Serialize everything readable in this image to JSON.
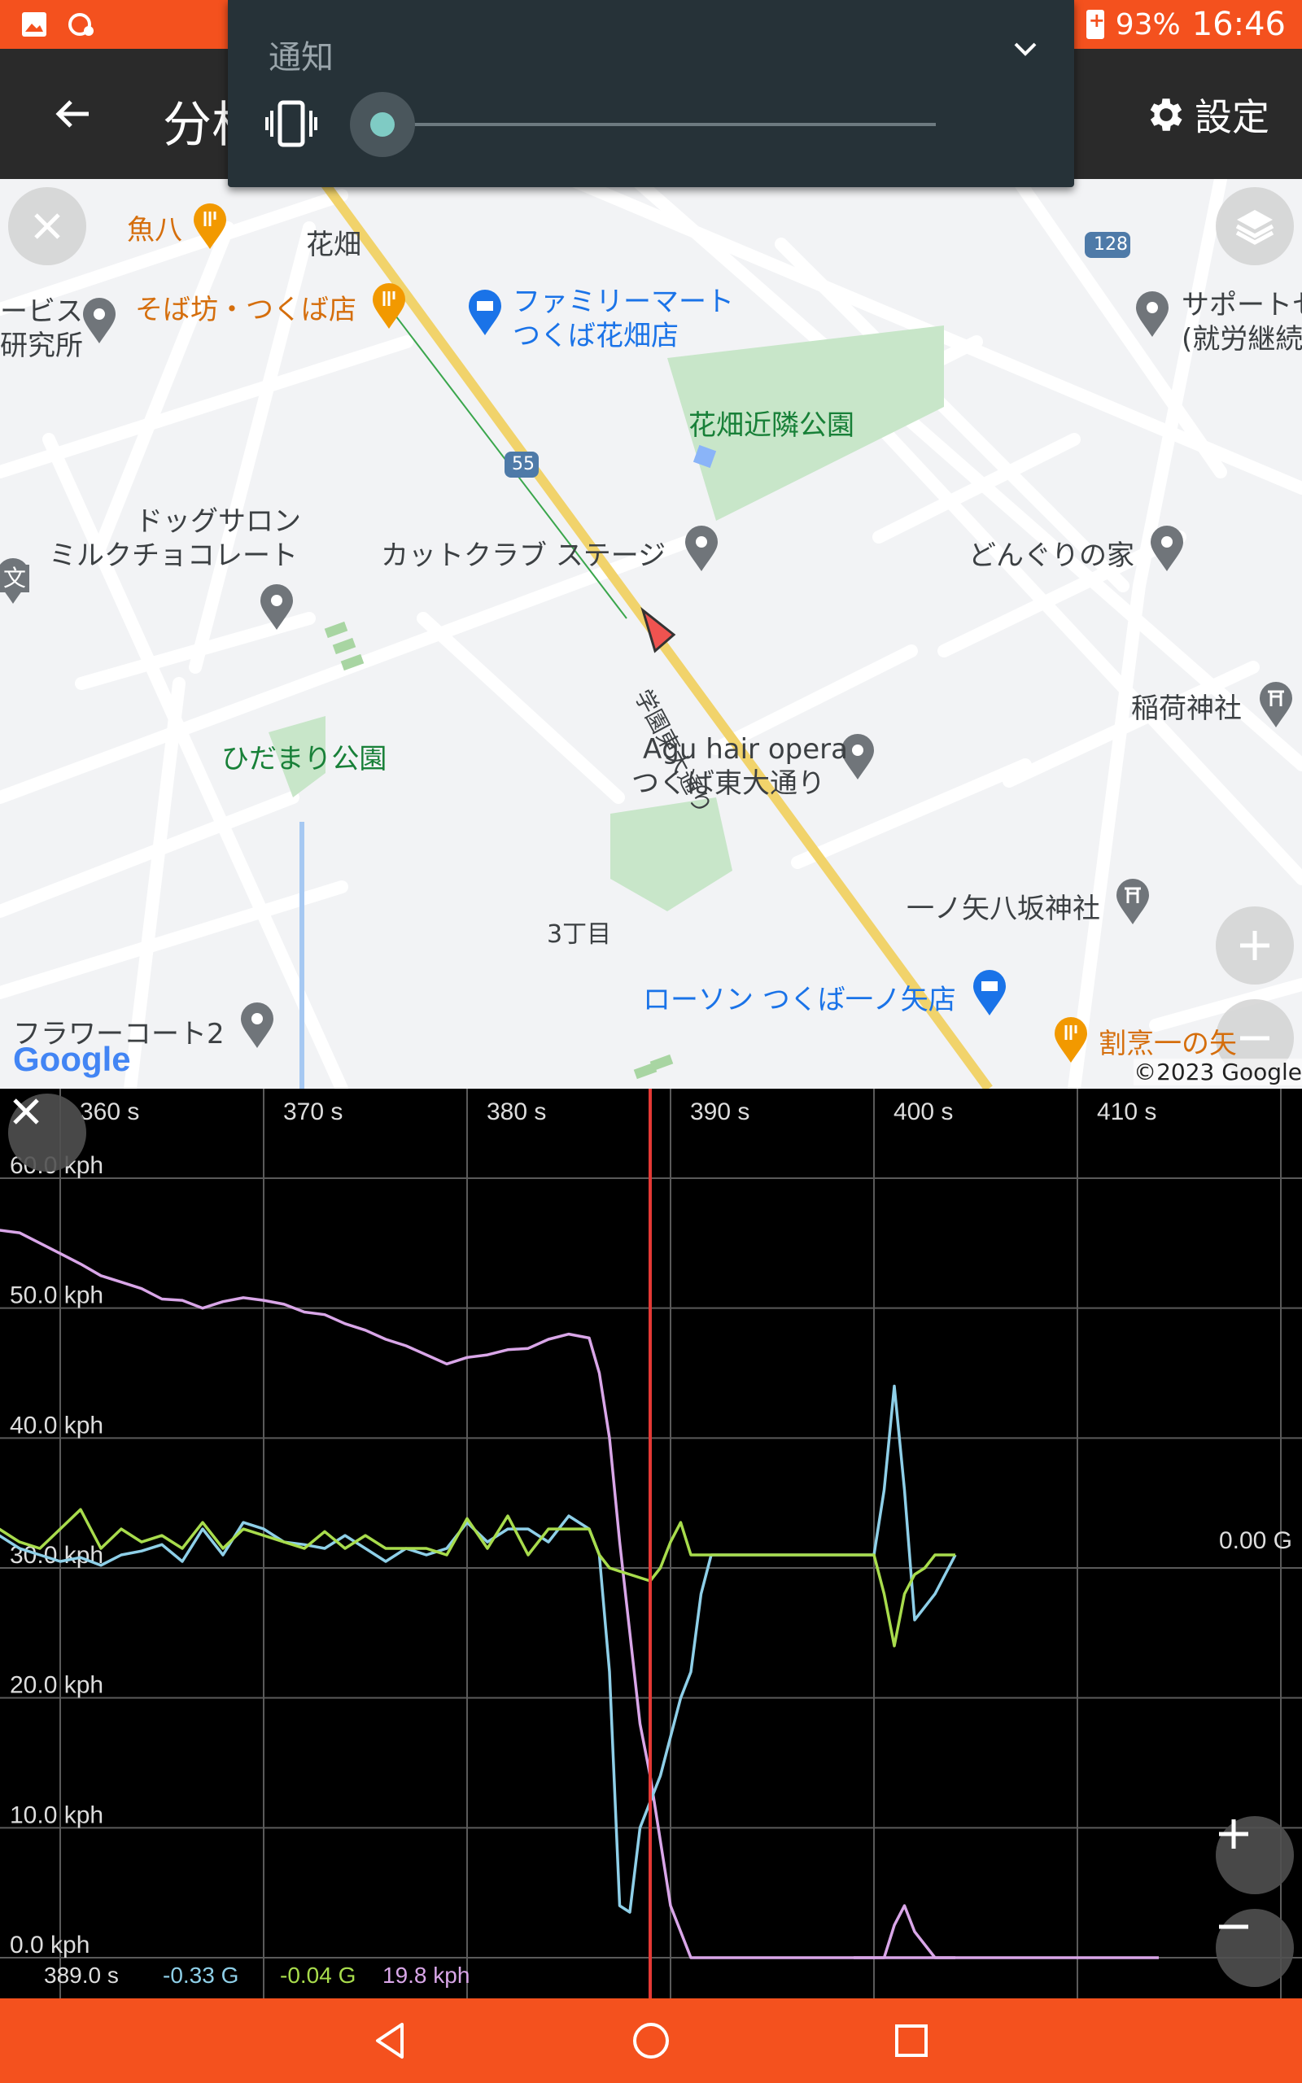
{
  "status_bar": {
    "battery": "93%",
    "time": "16:46"
  },
  "toolbar": {
    "title": "分析",
    "settings_label": "設定"
  },
  "volume_panel": {
    "label": "通知",
    "level": 0
  },
  "map": {
    "labels": {
      "uohachi": "魚八",
      "hanabatake": "花畑",
      "sobabo": "そば坊・つくば店",
      "familymart_1": "ファミリーマート",
      "familymart_2": "つくば花畑店",
      "route128": "128",
      "support_1": "サポートセ",
      "support_2": "(就労継続",
      "service_1": "ービス",
      "service_2": "研究所",
      "park_hanabatake": "花畑近隣公園",
      "route55": "55",
      "dogsalon_1": "ドッグサロン",
      "dogsalon_2": "ミルクチョコレート",
      "cutclub": "カットクラブ ステージ",
      "donguri": "どんぐりの家",
      "bun": "文",
      "road_gakuen": "学園東大通り",
      "inari": "稲荷神社",
      "hidamari": "ひだまり公園",
      "agu_1": "Agu hair opera",
      "agu_2": "つくば東大通り",
      "ichinoya": "一ノ矢八坂神社",
      "chome3": "3丁目",
      "lawson": "ローソン つくば一ノ矢店",
      "kappo": "割烹一の矢",
      "flower": "フラワーコート2"
    },
    "google_logo": "Google",
    "copyright": "©2023 Google"
  },
  "chart": {
    "readout": {
      "time": "389.0 s",
      "g_blue": "-0.33 G",
      "g_green": "-0.04 G",
      "speed": "19.8 kph"
    }
  },
  "colors": {
    "accent": "#f4511e",
    "speed_line": "#d9a6e8",
    "accel_blue": "#8ecfe8",
    "accel_green": "#a8dc4c",
    "cursor": "#e53935"
  },
  "chart_data": {
    "type": "line",
    "x_ticks": [
      "360 s",
      "370 s",
      "380 s",
      "390 s",
      "400 s",
      "410 s"
    ],
    "y_ticks": [
      "60.0 kph",
      "50.0 kph",
      "40.0 kph",
      "30.0 kph",
      "20.0 kph",
      "10.0 kph",
      "0.0 kph"
    ],
    "right_label": "0.00 G",
    "xlim": [
      357,
      414
    ],
    "ylim": [
      0,
      60
    ],
    "cursor_x": 389,
    "series": [
      {
        "color": "#d9a6e8",
        "x": [
          357,
          358,
          359,
          360,
          361,
          362,
          363,
          364,
          365,
          366,
          367,
          368,
          369,
          370,
          371,
          372,
          373,
          374,
          375,
          376,
          377,
          378,
          379,
          380,
          381,
          382,
          383,
          384,
          385,
          386,
          386.5,
          387,
          387.5,
          388,
          388.5,
          389,
          389.5,
          390,
          391,
          392,
          393,
          394,
          395,
          396,
          397,
          398,
          399,
          400,
          401,
          402,
          403,
          404,
          405,
          406,
          407,
          408,
          409,
          410,
          411,
          412,
          413,
          414
        ],
        "y": [
          56,
          55.8,
          55,
          54.2,
          53.4,
          52.5,
          52,
          51.5,
          50.7,
          50.6,
          50,
          50.5,
          50.8,
          50.6,
          50.3,
          49.7,
          49.5,
          48.8,
          48.3,
          47.6,
          47.1,
          46.4,
          45.7,
          46.2,
          46.4,
          46.8,
          46.9,
          47.6,
          48,
          47.7,
          45,
          40,
          32,
          25,
          18,
          14,
          9,
          4,
          0,
          0,
          0,
          0,
          0,
          0,
          0,
          0,
          0,
          0,
          0,
          0,
          0,
          0,
          0,
          0,
          0,
          0,
          0,
          0,
          0,
          0,
          0,
          0
        ]
      },
      {
        "color": "#8ecfe8",
        "x": [
          357,
          358,
          359,
          360,
          361,
          362,
          363,
          364,
          365,
          366,
          367,
          368,
          369,
          370,
          371,
          372,
          373,
          374,
          375,
          376,
          377,
          378,
          379,
          380,
          381,
          382,
          383,
          384,
          385,
          386,
          386.5,
          387,
          387.5,
          388,
          388.5,
          389,
          389.5,
          390,
          390.5,
          391,
          391.5,
          392,
          393,
          394,
          395,
          396,
          397,
          398,
          399,
          400,
          400.5,
          401,
          401.5,
          402,
          403,
          404
        ],
        "y": [
          32.5,
          31.5,
          31,
          30.5,
          30.8,
          30.2,
          31,
          31.3,
          31.8,
          30.5,
          33,
          31,
          33.5,
          33,
          32,
          31.8,
          31.5,
          32.5,
          31.5,
          30.5,
          31.5,
          31,
          31.5,
          33.5,
          32,
          33,
          33,
          32,
          34,
          33,
          31,
          22,
          4,
          3.5,
          10,
          12,
          14,
          17,
          20,
          22,
          28,
          31,
          31,
          31,
          31,
          31,
          31,
          31,
          31,
          31,
          36,
          44,
          36,
          26,
          28,
          31
        ]
      },
      {
        "color": "#a8dc4c",
        "x": [
          357,
          358,
          359,
          360,
          361,
          362,
          363,
          364,
          365,
          366,
          367,
          368,
          369,
          370,
          371,
          372,
          373,
          374,
          375,
          376,
          377,
          378,
          379,
          380,
          381,
          382,
          383,
          384,
          385,
          386,
          386.5,
          387,
          388,
          389,
          389.5,
          390,
          390.5,
          391,
          391.5,
          392,
          393,
          394,
          395,
          396,
          397,
          398,
          399,
          400,
          400.5,
          401,
          401.5,
          402,
          402.5,
          403,
          404
        ],
        "y": [
          33,
          32,
          31.5,
          33,
          34.5,
          31.5,
          33,
          32,
          32.5,
          31.5,
          33.5,
          31.5,
          33,
          32.5,
          32,
          31.5,
          32.8,
          31.5,
          32.5,
          31.5,
          31.5,
          31.5,
          31,
          33.8,
          31.5,
          34,
          31,
          33,
          33,
          33,
          31,
          30,
          29.5,
          29,
          30,
          32,
          33.5,
          31,
          31,
          31,
          31,
          31,
          31,
          31,
          31,
          31,
          31,
          31,
          28,
          24,
          28,
          29.5,
          30,
          31,
          31
        ]
      },
      {
        "color": "#d9a6e8",
        "x": [
          399,
          399.5,
          400,
          400.5,
          401,
          401.5,
          402,
          403,
          404
        ],
        "y": [
          0,
          0,
          0,
          0,
          2.5,
          4,
          2,
          0,
          0
        ]
      }
    ]
  }
}
